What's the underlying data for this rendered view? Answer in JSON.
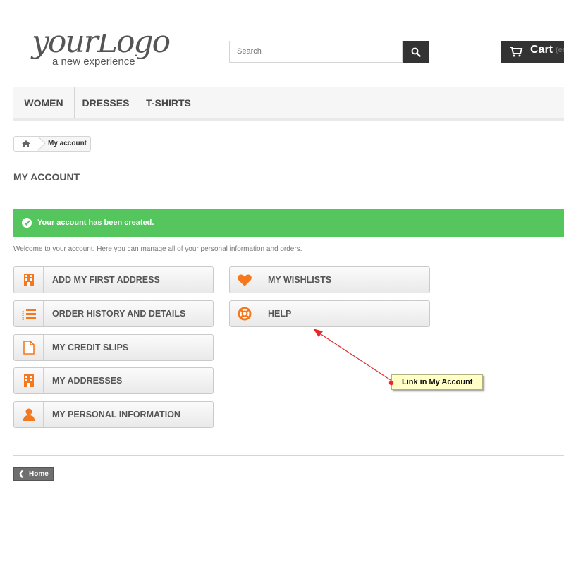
{
  "header": {
    "logo_script": "yourLogo",
    "logo_tagline": "a new experience",
    "search": {
      "placeholder": "Search"
    },
    "cart": {
      "label": "Cart",
      "empty": "(em"
    }
  },
  "nav": {
    "items": [
      "WOMEN",
      "DRESSES",
      "T-SHIRTS"
    ]
  },
  "breadcrumb": {
    "current": "My account"
  },
  "page": {
    "title": "MY ACCOUNT",
    "alert": "Your account has been created.",
    "welcome": "Welcome to your account. Here you can manage all of your personal information and orders."
  },
  "links": {
    "left": [
      {
        "label": "ADD MY FIRST ADDRESS",
        "icon": "building-icon"
      },
      {
        "label": "ORDER HISTORY AND DETAILS",
        "icon": "list-ol-icon"
      },
      {
        "label": "MY CREDIT SLIPS",
        "icon": "file-icon"
      },
      {
        "label": "MY ADDRESSES",
        "icon": "building-icon"
      },
      {
        "label": "MY PERSONAL INFORMATION",
        "icon": "user-icon"
      }
    ],
    "right": [
      {
        "label": "MY WISHLISTS",
        "icon": "heart-icon"
      },
      {
        "label": "HELP",
        "icon": "life-ring-icon"
      }
    ]
  },
  "footer": {
    "home": "Home"
  },
  "annotation": {
    "text": "Link in My Account"
  },
  "colors": {
    "accent": "#f5781e",
    "success": "#55c65e",
    "dark": "#333333",
    "callout": "#ffffc6",
    "arrow": "#e8282b"
  }
}
